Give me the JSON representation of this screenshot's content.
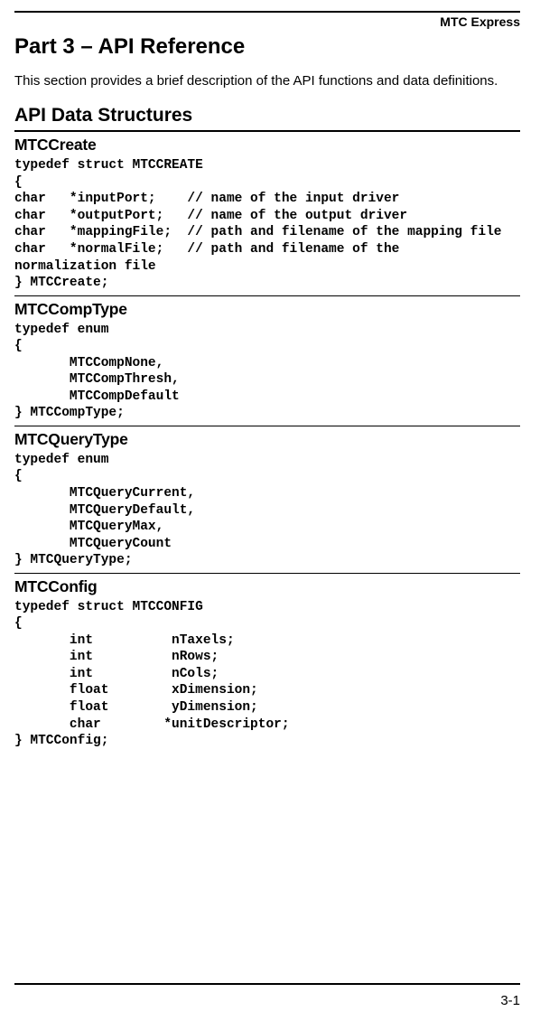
{
  "header": "MTC Express",
  "partTitle": "Part 3 – API Reference",
  "intro": "This section provides a brief description of the API functions and data definitions.",
  "sectionTitle": "API Data Structures",
  "structs": {
    "mtcCreate": {
      "name": "MTCCreate",
      "code": "typedef struct MTCCREATE\n{\nchar   *inputPort;    // name of the input driver\nchar   *outputPort;   // name of the output driver\nchar   *mappingFile;  // path and filename of the mapping file\nchar   *normalFile;   // path and filename of the\nnormalization file\n} MTCCreate;"
    },
    "mtcCompType": {
      "name": "MTCCompType",
      "code": "typedef enum\n{\n       MTCCompNone,\n       MTCCompThresh,\n       MTCCompDefault\n} MTCCompType;"
    },
    "mtcQueryType": {
      "name": "MTCQueryType",
      "code": "typedef enum\n{\n       MTCQueryCurrent,\n       MTCQueryDefault,\n       MTCQueryMax,\n       MTCQueryCount\n} MTCQueryType;"
    },
    "mtcConfig": {
      "name": "MTCConfig",
      "code": "typedef struct MTCCONFIG\n{\n       int          nTaxels;\n       int          nRows;\n       int          nCols;\n       float        xDimension;\n       float        yDimension;\n       char        *unitDescriptor;\n} MTCConfig;"
    }
  },
  "pageNumber": "3-1"
}
